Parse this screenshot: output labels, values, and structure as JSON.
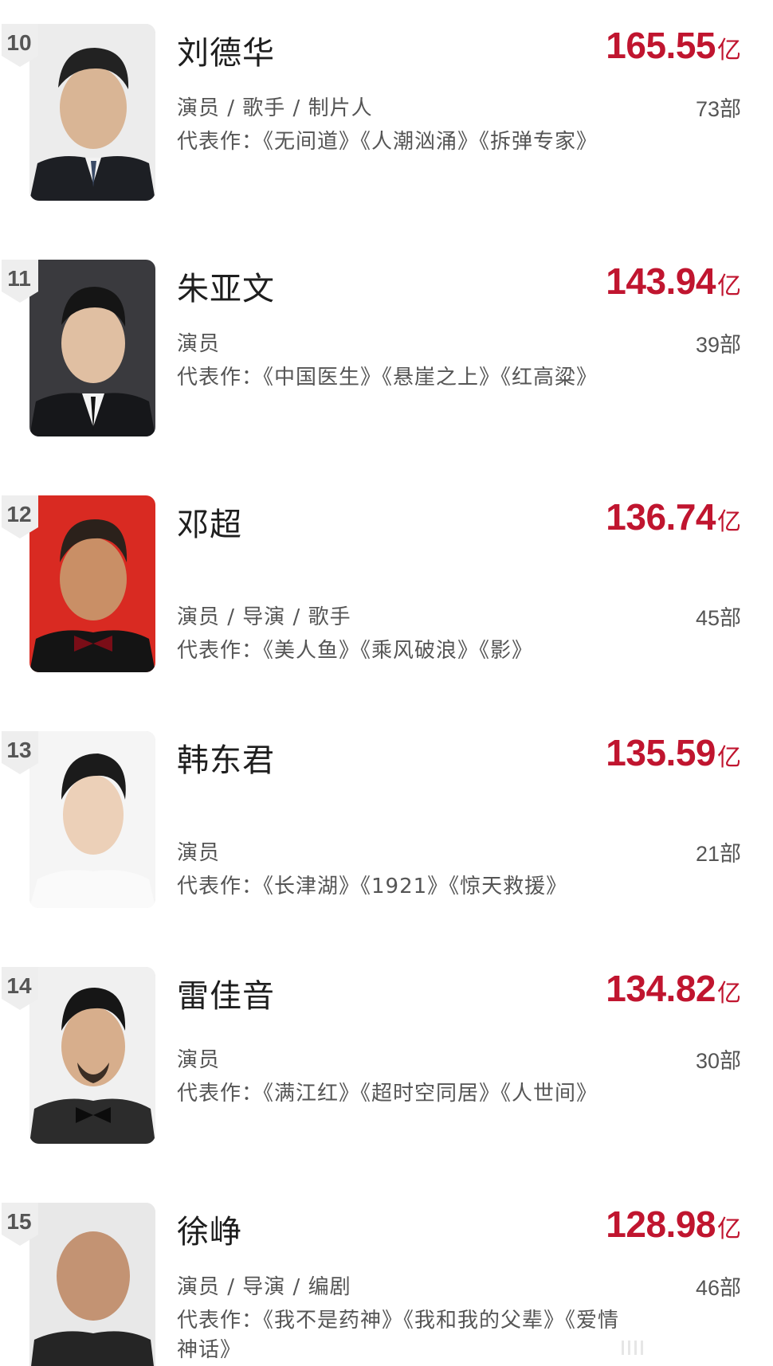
{
  "colors": {
    "box_office": "#c0152f",
    "text_primary": "#1e1e1e",
    "text_secondary": "#555555",
    "rank_badge": "#eeeeee"
  },
  "entries": [
    {
      "rank": "10",
      "name": "刘德华",
      "box_office": "165.55",
      "unit": "亿",
      "roles": "演员 / 歌手 / 制片人",
      "films": "73部",
      "works": "代表作：《无间道》《人潮汹涌》《拆弹专家》"
    },
    {
      "rank": "11",
      "name": "朱亚文",
      "box_office": "143.94",
      "unit": "亿",
      "roles": "演员",
      "films": "39部",
      "works": "代表作：《中国医生》《悬崖之上》《红高粱》"
    },
    {
      "rank": "12",
      "name": "邓超",
      "box_office": "136.74",
      "unit": "亿",
      "roles": "演员 / 导演 / 歌手",
      "films": "45部",
      "works": "代表作：《美人鱼》《乘风破浪》《影》"
    },
    {
      "rank": "13",
      "name": "韩东君",
      "box_office": "135.59",
      "unit": "亿",
      "roles": "演员",
      "films": "21部",
      "works": "代表作：《长津湖》《1921》《惊天救援》"
    },
    {
      "rank": "14",
      "name": "雷佳音",
      "box_office": "134.82",
      "unit": "亿",
      "roles": "演员",
      "films": "30部",
      "works": "代表作：《满江红》《超时空同居》《人世间》"
    },
    {
      "rank": "15",
      "name": "徐峥",
      "box_office": "128.98",
      "unit": "亿",
      "roles": "演员 / 导演 / 编剧",
      "films": "46部",
      "works": "代表作：《我不是药神》《我和我的父辈》《爱情神话》"
    }
  ]
}
